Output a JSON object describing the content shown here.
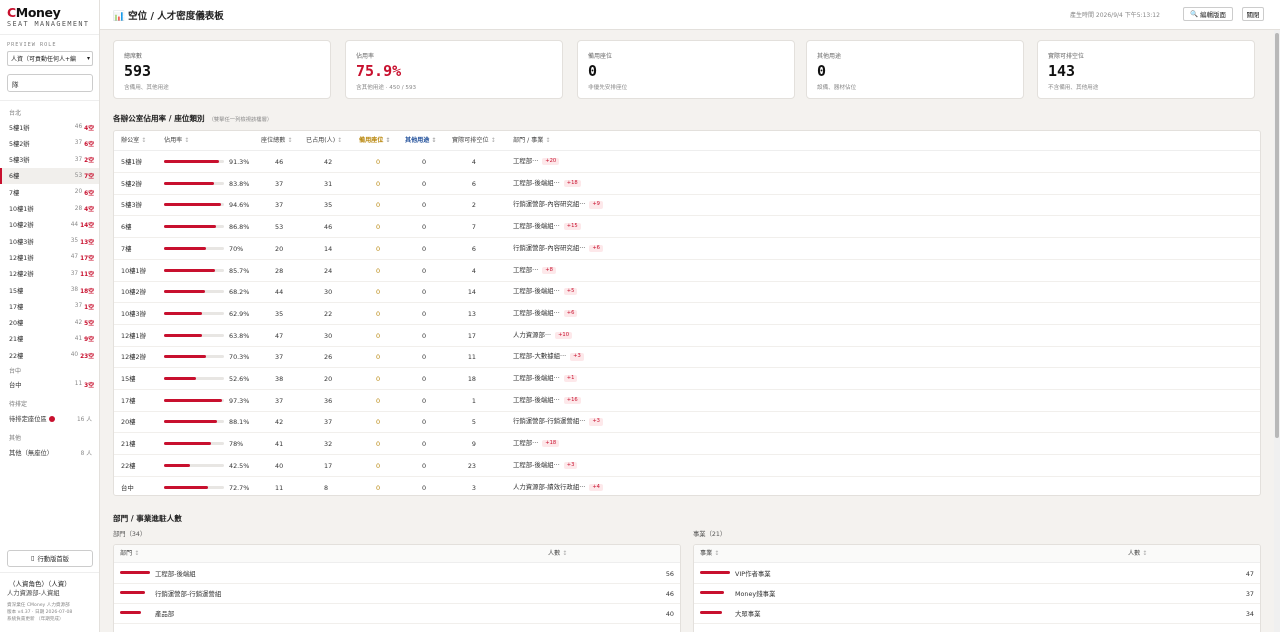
{
  "sidebar": {
    "logo_c": "C",
    "logo_rest": "Money",
    "logo_sub": "SEAT MANAGEMENT",
    "preview_role_label": "PREVIEW ROLE",
    "role_value": "人資（可貢動任何人+編",
    "search_value": "隊",
    "groups": {
      "taibei": "台北",
      "taichung": "台中",
      "pending": "待排定",
      "other": "其他"
    },
    "items": [
      {
        "name": "5樓1辦",
        "count": "46",
        "vacant": "4空"
      },
      {
        "name": "5樓2辦",
        "count": "37",
        "vacant": "6空"
      },
      {
        "name": "5樓3辦",
        "count": "37",
        "vacant": "2空"
      },
      {
        "name": "6樓",
        "count": "53",
        "vacant": "7空"
      },
      {
        "name": "7樓",
        "count": "20",
        "vacant": "6空"
      },
      {
        "name": "10樓1辦",
        "count": "28",
        "vacant": "4空"
      },
      {
        "name": "10樓2辦",
        "count": "44",
        "vacant": "14空"
      },
      {
        "name": "10樓3辦",
        "count": "35",
        "vacant": "13空"
      },
      {
        "name": "12樓1辦",
        "count": "47",
        "vacant": "17空"
      },
      {
        "name": "12樓2辦",
        "count": "37",
        "vacant": "11空"
      },
      {
        "name": "15樓",
        "count": "38",
        "vacant": "18空"
      },
      {
        "name": "17樓",
        "count": "37",
        "vacant": "1空"
      },
      {
        "name": "20樓",
        "count": "42",
        "vacant": "5空"
      },
      {
        "name": "21樓",
        "count": "41",
        "vacant": "9空"
      },
      {
        "name": "22樓",
        "count": "40",
        "vacant": "23空"
      }
    ],
    "taichung_item": {
      "name": "台中",
      "count": "11",
      "vacant": "3空"
    },
    "pending_item": {
      "name": "待排定座位區",
      "count": "16 人"
    },
    "other_item": {
      "name": "其他（無座位）",
      "count": "8 人"
    },
    "mobile_button": "行動版首版",
    "user_role": "（人資角色）（人資）",
    "user_dept": "人力資源部-人資組",
    "footer_lines": [
      "資深業任 CMoney 人力資源部",
      "版本 v4.37 · 日期 2026-07-08",
      "系統負責更新 （年期完成）"
    ]
  },
  "topbar": {
    "title": "空位 / 人才密度儀表板",
    "gen_time": "產生時間 2026/9/4 下午5:13:12",
    "edit_button": "編輯版面",
    "close_button": "關閉"
  },
  "cards": [
    {
      "label": "總席數",
      "value": "593",
      "sub": "含備用、其他用途"
    },
    {
      "label": "佔用率",
      "value": "75.9%",
      "sub": "含其他用途 · 450 / 593"
    },
    {
      "label": "備用座位",
      "value": "0",
      "sub": "非優先安排座位"
    },
    {
      "label": "其他用途",
      "value": "0",
      "sub": "設備、器材佔位"
    },
    {
      "label": "實際可排空位",
      "value": "143",
      "sub": "不含備用、其他用途"
    }
  ],
  "section1": {
    "title": "各辦公室佔用率 / 座位類別",
    "hint": "（雙擊任一列檢視該樓層）",
    "headers": [
      "辦公室",
      "佔用率",
      "座位總數",
      "已占用(人)",
      "備用座位",
      "其他用途",
      "實際可排空位",
      "部門 / 事業"
    ],
    "rows": [
      {
        "office": "5樓1辦",
        "rate": "91.3%",
        "pct": 91.3,
        "total": "46",
        "occupied": "42",
        "reserve": "0",
        "other": "0",
        "avail": "4",
        "dept": "工程部···",
        "badge": "+20"
      },
      {
        "office": "5樓2辦",
        "rate": "83.8%",
        "pct": 83.8,
        "total": "37",
        "occupied": "31",
        "reserve": "0",
        "other": "0",
        "avail": "6",
        "dept": "工程部-後端組···",
        "badge": "+18"
      },
      {
        "office": "5樓3辦",
        "rate": "94.6%",
        "pct": 94.6,
        "total": "37",
        "occupied": "35",
        "reserve": "0",
        "other": "0",
        "avail": "2",
        "dept": "行銷運營部-內容研究組···",
        "badge": "+9"
      },
      {
        "office": "6樓",
        "rate": "86.8%",
        "pct": 86.8,
        "total": "53",
        "occupied": "46",
        "reserve": "0",
        "other": "0",
        "avail": "7",
        "dept": "工程部-後端組···",
        "badge": "+15"
      },
      {
        "office": "7樓",
        "rate": "70%",
        "pct": 70,
        "total": "20",
        "occupied": "14",
        "reserve": "0",
        "other": "0",
        "avail": "6",
        "dept": "行銷運營部-內容研究組···",
        "badge": "+6"
      },
      {
        "office": "10樓1辦",
        "rate": "85.7%",
        "pct": 85.7,
        "total": "28",
        "occupied": "24",
        "reserve": "0",
        "other": "0",
        "avail": "4",
        "dept": "工程部···",
        "badge": "+8"
      },
      {
        "office": "10樓2辦",
        "rate": "68.2%",
        "pct": 68.2,
        "total": "44",
        "occupied": "30",
        "reserve": "0",
        "other": "0",
        "avail": "14",
        "dept": "工程部-後端組···",
        "badge": "+5"
      },
      {
        "office": "10樓3辦",
        "rate": "62.9%",
        "pct": 62.9,
        "total": "35",
        "occupied": "22",
        "reserve": "0",
        "other": "0",
        "avail": "13",
        "dept": "工程部-後端組···",
        "badge": "+6"
      },
      {
        "office": "12樓1辦",
        "rate": "63.8%",
        "pct": 63.8,
        "total": "47",
        "occupied": "30",
        "reserve": "0",
        "other": "0",
        "avail": "17",
        "dept": "人力資源部···",
        "badge": "+10"
      },
      {
        "office": "12樓2辦",
        "rate": "70.3%",
        "pct": 70.3,
        "total": "37",
        "occupied": "26",
        "reserve": "0",
        "other": "0",
        "avail": "11",
        "dept": "工程部-大數據組···",
        "badge": "+3"
      },
      {
        "office": "15樓",
        "rate": "52.6%",
        "pct": 52.6,
        "total": "38",
        "occupied": "20",
        "reserve": "0",
        "other": "0",
        "avail": "18",
        "dept": "工程部-後端組···",
        "badge": "+1"
      },
      {
        "office": "17樓",
        "rate": "97.3%",
        "pct": 97.3,
        "total": "37",
        "occupied": "36",
        "reserve": "0",
        "other": "0",
        "avail": "1",
        "dept": "工程部-後端組···",
        "badge": "+16"
      },
      {
        "office": "20樓",
        "rate": "88.1%",
        "pct": 88.1,
        "total": "42",
        "occupied": "37",
        "reserve": "0",
        "other": "0",
        "avail": "5",
        "dept": "行銷運營部-行銷運營組···",
        "badge": "+3"
      },
      {
        "office": "21樓",
        "rate": "78%",
        "pct": 78,
        "total": "41",
        "occupied": "32",
        "reserve": "0",
        "other": "0",
        "avail": "9",
        "dept": "工程部···",
        "badge": "+18"
      },
      {
        "office": "22樓",
        "rate": "42.5%",
        "pct": 42.5,
        "total": "40",
        "occupied": "17",
        "reserve": "0",
        "other": "0",
        "avail": "23",
        "dept": "工程部-後端組···",
        "badge": "+3"
      },
      {
        "office": "台中",
        "rate": "72.7%",
        "pct": 72.7,
        "total": "11",
        "occupied": "8",
        "reserve": "0",
        "other": "0",
        "avail": "3",
        "dept": "人力資源部-績效行政組···",
        "badge": "+4"
      }
    ]
  },
  "section2": {
    "title": "部門 / 事業進駐人數",
    "dept_label": "部門（34）",
    "biz_label": "事業（21）",
    "dept_headers": [
      "部門",
      "人數"
    ],
    "biz_headers": [
      "事業",
      "人數"
    ],
    "dept_rows": [
      {
        "name": "工程部-後端組",
        "count": "56"
      },
      {
        "name": "行銷運營部-行銷運營組",
        "count": "46"
      },
      {
        "name": "產品部",
        "count": "40"
      }
    ],
    "biz_rows": [
      {
        "name": "VIP作者事業",
        "count": "47"
      },
      {
        "name": "Money錢事業",
        "count": "37"
      },
      {
        "name": "大眾事業",
        "count": "34"
      }
    ]
  },
  "colors": {
    "accent": "#c8102e",
    "reserve": "#b8860b",
    "other": "#1f4e99"
  }
}
